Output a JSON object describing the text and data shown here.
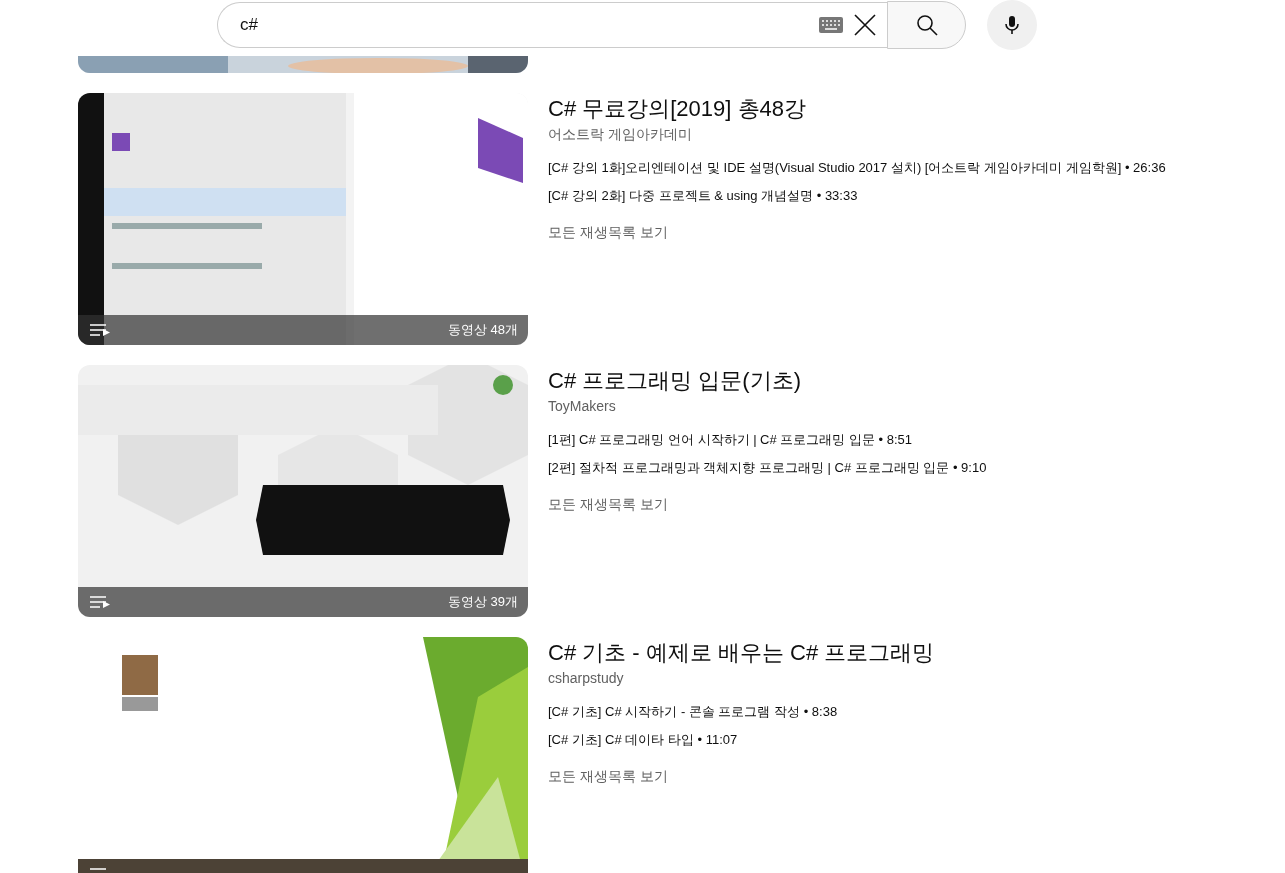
{
  "search": {
    "value": "c#"
  },
  "playlists": [
    {
      "title": "C# 무료강의[2019] 총48강",
      "channel": "어소트락 게임아카데미",
      "video_count": "동영상 48개",
      "videos": [
        "[C# 강의 1화]오리엔테이션 및 IDE 설명(Visual Studio 2017 설치) [어소트락 게임아카데미 게임학원] • 26:36",
        "[C# 강의 2화] 다중 프로젝트 & using 개념설명 • 33:33"
      ],
      "view_all": "모든 재생목록 보기"
    },
    {
      "title": "C# 프로그래밍 입문(기초)",
      "channel": "ToyMakers",
      "video_count": "동영상 39개",
      "videos": [
        "[1편] C# 프로그래밍 언어 시작하기 | C# 프로그래밍 입문 • 8:51",
        "[2편] 절차적 프로그래밍과 객체지향 프로그래밍 | C# 프로그래밍 입문 • 9:10"
      ],
      "view_all": "모든 재생목록 보기"
    },
    {
      "title": "C# 기초 - 예제로 배우는 C# 프로그래밍",
      "channel": "csharpstudy",
      "videos": [
        "[C# 기초] C# 시작하기 - 콘솔 프로그램 작성 • 8:38",
        "[C# 기초] C# 데이타 타입 • 11:07"
      ],
      "view_all": "모든 재생목록 보기"
    }
  ]
}
